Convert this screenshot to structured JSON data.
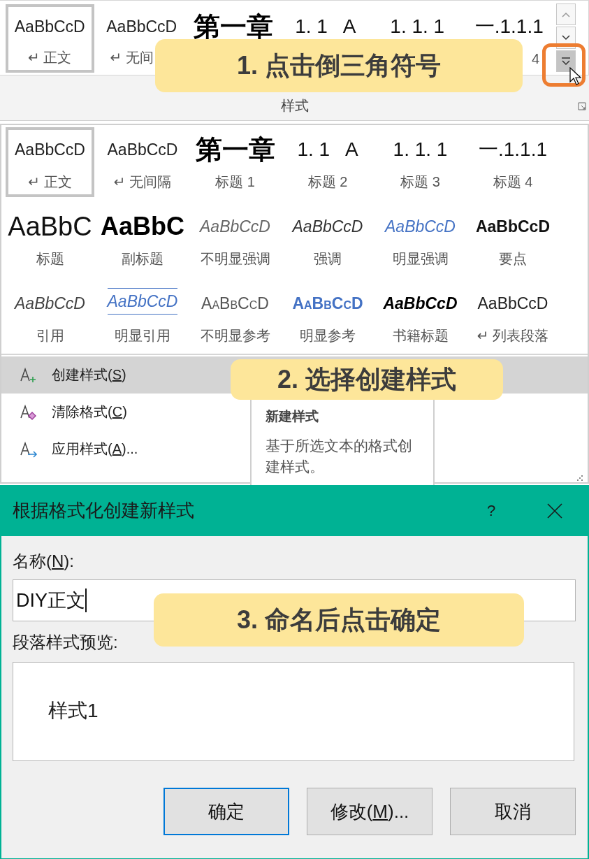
{
  "ribbon": {
    "gallery": [
      {
        "sample": "AaBbCcD",
        "kind": "normal",
        "label": "↵ 正文",
        "selected": true
      },
      {
        "sample": "AaBbCcD",
        "kind": "normal",
        "label": "↵ 无间",
        "selected": false
      },
      {
        "sample": "第一章",
        "kind": "cjk-heading",
        "selected": false
      },
      {
        "sample": "1. 1   A",
        "kind": "number",
        "selected": false
      },
      {
        "sample": "1. 1. 1",
        "kind": "number",
        "selected": false
      },
      {
        "sample": "一.1.1.1",
        "kind": "number",
        "label": "4",
        "selected": false
      }
    ],
    "group_label": "样式",
    "callout": "1. 点击倒三角符号"
  },
  "style_gallery": {
    "items": [
      {
        "sample": "AaBbCcD",
        "kind": "normal",
        "label": "↵ 正文",
        "selected": true
      },
      {
        "sample": "AaBbCcD",
        "kind": "normal",
        "label": "↵ 无间隔",
        "selected": false
      },
      {
        "sample": "第一章",
        "kind": "cjk-heading",
        "label": "标题 1",
        "selected": false
      },
      {
        "sample": "1. 1   A",
        "kind": "number",
        "label": "标题 2",
        "selected": false
      },
      {
        "sample": "1. 1. 1",
        "kind": "number",
        "label": "标题 3",
        "selected": false
      },
      {
        "sample": "一.1.1.1",
        "kind": "number",
        "label": "标题 4",
        "selected": false
      },
      {
        "sample": "AaBbC",
        "kind": "title",
        "label": "标题",
        "selected": false
      },
      {
        "sample": "AaBbC",
        "kind": "subtitle",
        "label": "副标题",
        "selected": false
      },
      {
        "sample": "AaBbCcD",
        "kind": "subtle-emphasis",
        "label": "不明显强调",
        "selected": false
      },
      {
        "sample": "AaBbCcD",
        "kind": "emphasis",
        "label": "强调",
        "selected": false
      },
      {
        "sample": "AaBbCcD",
        "kind": "intense-emphasis",
        "label": "明显强调",
        "selected": false
      },
      {
        "sample": "AaBbCcD",
        "kind": "strong",
        "label": "要点",
        "selected": false
      },
      {
        "sample": "AaBbCcD",
        "kind": "quote",
        "label": "引用",
        "selected": false
      },
      {
        "sample": "AaBbCcD",
        "kind": "intense-quote",
        "label": "明显引用",
        "selected": false
      },
      {
        "sample": "AaBbCcD",
        "kind": "subtle-reference",
        "label": "不明显参考",
        "selected": false
      },
      {
        "sample": "AaBbCcD",
        "kind": "intense-reference",
        "label": "明显参考",
        "selected": false
      },
      {
        "sample": "AaBbCcD",
        "kind": "book-title",
        "label": "书籍标题",
        "selected": false
      },
      {
        "sample": "AaBbCcD",
        "kind": "normal",
        "label": "↵ 列表段落",
        "selected": false
      }
    ]
  },
  "style_menu": {
    "items": [
      {
        "kind": "create",
        "label": [
          "创建样式(",
          "S",
          ")"
        ],
        "selected": true
      },
      {
        "kind": "clear",
        "label": [
          "清除格式(",
          "C",
          ")"
        ],
        "selected": false
      },
      {
        "kind": "apply",
        "label": [
          "应用样式(",
          "A",
          ")..."
        ],
        "selected": false
      }
    ],
    "callout": "2. 选择创建样式",
    "tooltip": {
      "title": "新建样式",
      "text": "基于所选文本的格式创建样式。"
    }
  },
  "dialog": {
    "title": "根据格式化创建新样式",
    "help": "?",
    "name_label": [
      "名称(",
      "N",
      "):"
    ],
    "name_value": "DIY正文",
    "callout": "3. 命名后点击确定",
    "preview_label": "段落样式预览:",
    "preview_text": "样式1",
    "buttons": [
      {
        "label": [
          "确定"
        ],
        "default": true
      },
      {
        "label": [
          "修改(",
          "M",
          ")..."
        ],
        "default": false
      },
      {
        "label": [
          "取消"
        ],
        "default": false
      }
    ]
  }
}
